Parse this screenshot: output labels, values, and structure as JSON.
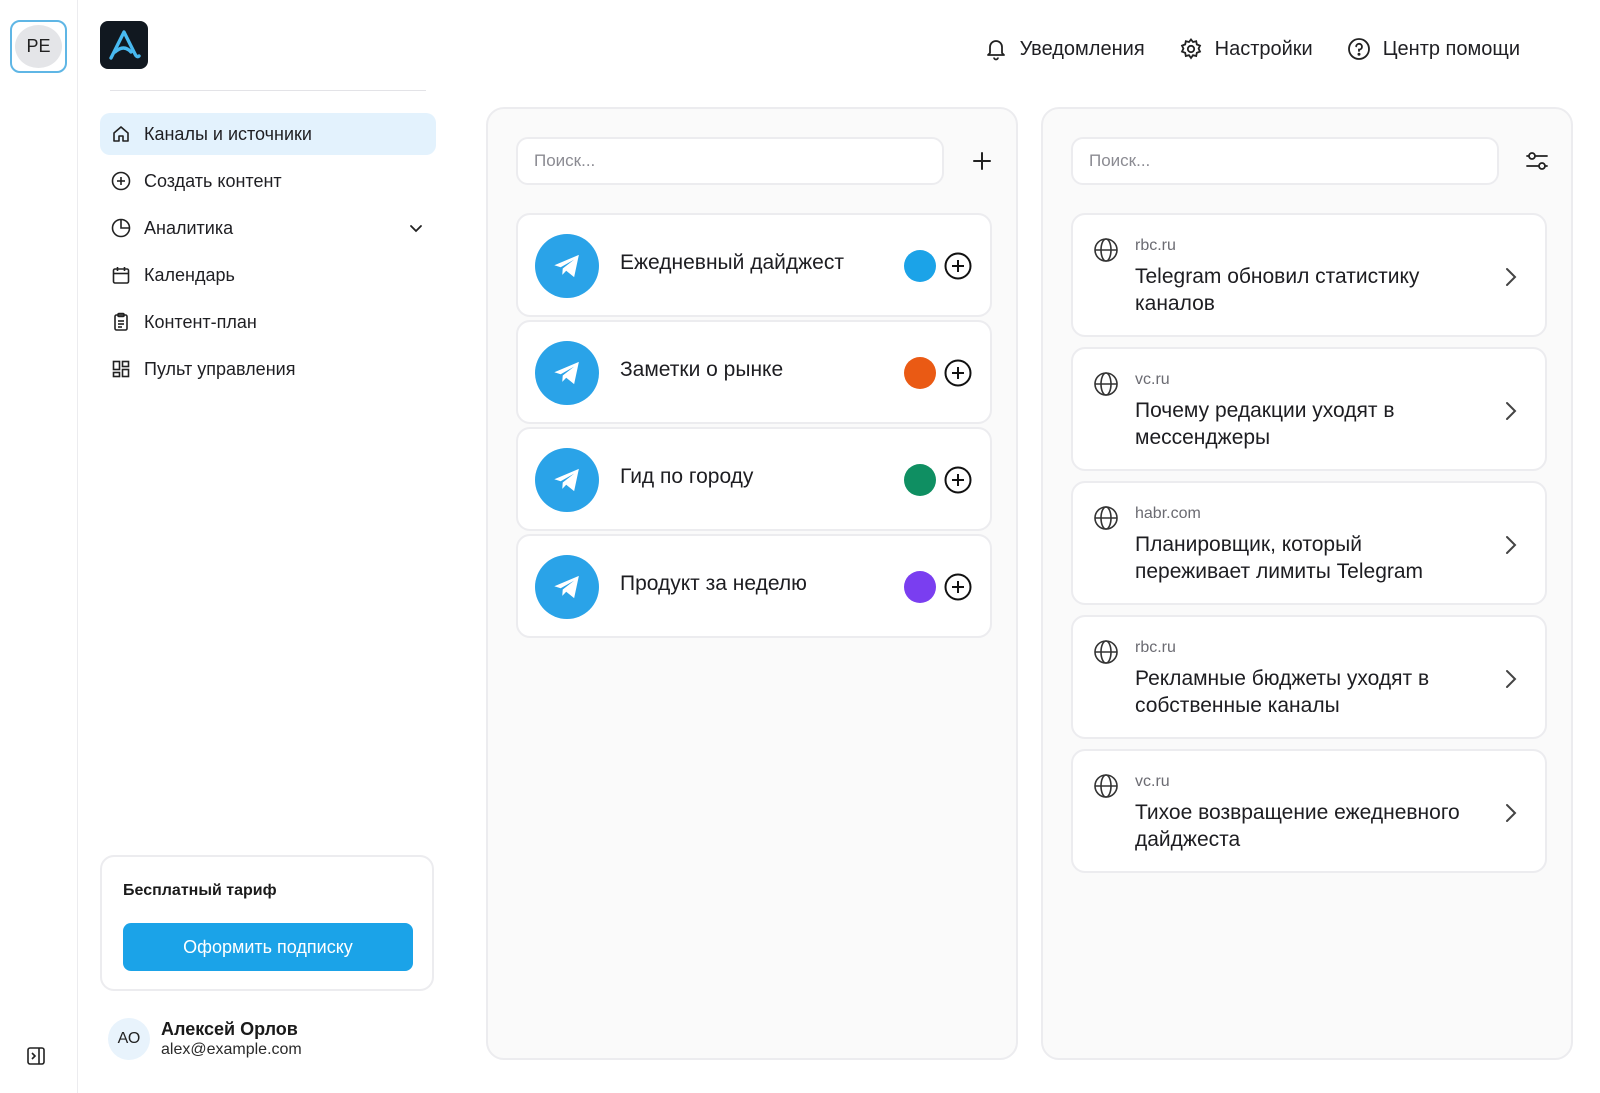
{
  "rail": {
    "workspace_initials": "PE"
  },
  "sidebar": {
    "nav": [
      {
        "label": "Каналы и источники",
        "icon": "home-icon",
        "active": true
      },
      {
        "label": "Создать контент",
        "icon": "plus-circle-icon"
      },
      {
        "label": "Аналитика",
        "icon": "pie-chart-icon",
        "expandable": true
      },
      {
        "label": "Календарь",
        "icon": "calendar-icon"
      },
      {
        "label": "Контент-план",
        "icon": "clipboard-icon"
      },
      {
        "label": "Пульт управления",
        "icon": "dashboard-icon"
      }
    ],
    "plan": {
      "title": "Бесплатный тариф",
      "button": "Оформить подписку"
    },
    "user": {
      "initials": "АО",
      "name": "Алексей Орлов",
      "email": "alex@example.com"
    }
  },
  "topbar": {
    "notifications": "Уведомления",
    "settings": "Настройки",
    "help": "Центр помощи"
  },
  "channels_panel": {
    "search_placeholder": "Поиск...",
    "channels": [
      {
        "name": "Ежедневный дайджест",
        "color": "#1ba3e8"
      },
      {
        "name": "Заметки о рынке",
        "color": "#ea5a14"
      },
      {
        "name": "Гид по городу",
        "color": "#0f8f62"
      },
      {
        "name": "Продукт за неделю",
        "color": "#7a3ef0"
      }
    ]
  },
  "sources_panel": {
    "search_placeholder": "Поиск...",
    "items": [
      {
        "source": "rbc.ru",
        "headline": "Telegram обновил статистику каналов"
      },
      {
        "source": "vc.ru",
        "headline": "Почему редакции уходят в мессенджеры"
      },
      {
        "source": "habr.com",
        "headline": "Планировщик, который переживает лимиты Telegram"
      },
      {
        "source": "rbc.ru",
        "headline": "Рекламные бюджеты уходят в собственные каналы"
      },
      {
        "source": "vc.ru",
        "headline": "Тихое возвращение ежедневного дайджеста"
      }
    ]
  },
  "colors": {
    "accent": "#1ba3e8",
    "active_nav_bg": "#e3f2fd",
    "telegram": "#2aa3e8"
  }
}
